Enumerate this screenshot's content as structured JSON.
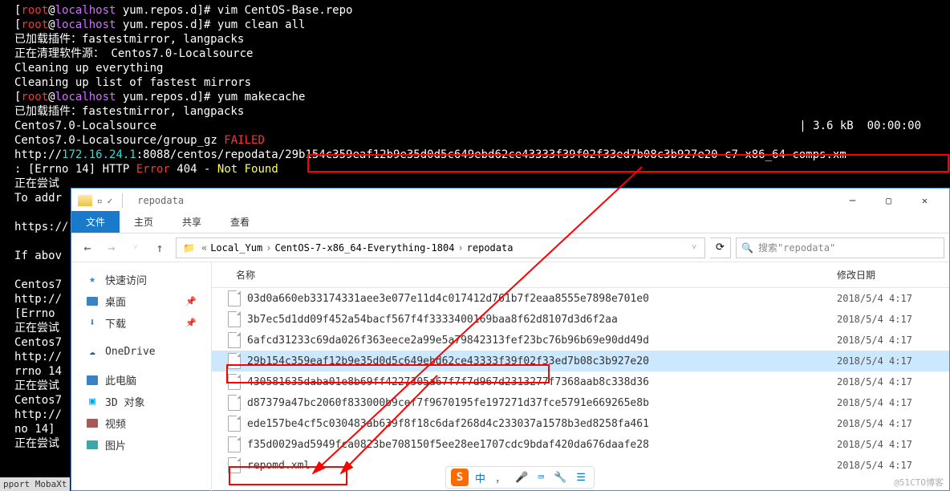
{
  "terminal": {
    "lines": [
      {
        "prompt": true,
        "cmd": "vim CentOS-Base.repo"
      },
      {
        "prompt": true,
        "cmd": "yum clean all"
      },
      {
        "text": "已加载插件：fastestmirror, langpacks"
      },
      {
        "text": "正在清理软件源： Centos7.0-Localsource"
      },
      {
        "text": "Cleaning up everything"
      },
      {
        "text": "Cleaning up list of fastest mirrors"
      },
      {
        "prompt": true,
        "cmd": "yum makecache"
      },
      {
        "text": "已加载插件：fastestmirror, langpacks"
      },
      {
        "text_left": "Centos7.0-Localsource",
        "text_right": "| 3.6 kB  00:00:00"
      },
      {
        "segments": [
          {
            "t": "Centos7.0-Localsource/group_gz ",
            "c": "w"
          },
          {
            "t": "FAILED",
            "c": "red"
          }
        ]
      },
      {
        "segments": [
          {
            "t": "http://",
            "c": "w"
          },
          {
            "t": "172.16.24.1",
            "c": "cyan"
          },
          {
            "t": ":8088/centos/repodata/29b154c359eaf12b9e35d0d5c649ebd62ce43333f39f02f33ed7b08c3b927e20-c7-x86_64-comps.xm",
            "c": "w"
          }
        ]
      },
      {
        "segments": [
          {
            "t": ": [Errno 14] HTTP ",
            "c": "w"
          },
          {
            "t": "Error",
            "c": "red"
          },
          {
            "t": " 404 - ",
            "c": "w"
          },
          {
            "t": "Not Found",
            "c": "yellow"
          }
        ]
      },
      {
        "text": "正在尝试"
      },
      {
        "text": "To addr"
      },
      {
        "text": ""
      },
      {
        "text": "https://"
      },
      {
        "text": ""
      },
      {
        "text": "If abov"
      },
      {
        "text": ""
      },
      {
        "text": "Centos7"
      },
      {
        "text": "http://"
      },
      {
        "text": "[Errno "
      },
      {
        "text": "正在尝试"
      },
      {
        "text": "Centos7"
      },
      {
        "text": "http://"
      },
      {
        "text": "rrno 14"
      },
      {
        "text": "正在尝试"
      },
      {
        "text": "Centos7"
      },
      {
        "text": "http://"
      },
      {
        "text": "no 14] "
      },
      {
        "text": "正在尝试"
      }
    ],
    "prompt_user": "root",
    "prompt_host": "localhost",
    "prompt_path": "yum.repos.d"
  },
  "explorer": {
    "title": "repodata",
    "tabs": {
      "file": "文件",
      "home": "主页",
      "share": "共享",
      "view": "查看"
    },
    "breadcrumb": [
      "Local_Yum",
      "CentOS-7-x86_64-Everything-1804",
      "repodata"
    ],
    "search_placeholder": "搜索\"repodata\"",
    "columns": {
      "name": "名称",
      "date": "修改日期"
    },
    "sidebar": {
      "quick": "快速访问",
      "desktop": "桌面",
      "downloads": "下载",
      "onedrive": "OneDrive",
      "thispc": "此电脑",
      "3d": "3D 对象",
      "videos": "视频",
      "pictures": "图片"
    },
    "files": [
      {
        "name": "03d0a660eb33174331aee3e077e11d4c017412d761b7f2eaa8555e7898e701e0",
        "date": "2018/5/4 4:17"
      },
      {
        "name": "3b7ec5d1dd09f452a54bacf567f4f3333400169baa8f62d8107d3d6f2aa",
        "date": "2018/5/4 4:17"
      },
      {
        "name": "6afcd31233c69da026f363eece2a99e5a79842313fef23bc76b96b69e90dd49d",
        "date": "2018/5/4 4:17"
      },
      {
        "name": "29b154c359eaf12b9e35d0d5c649ebd62ce43333f39f02f33ed7b08c3b927e20",
        "date": "2018/5/4 4:17",
        "selected": true
      },
      {
        "name": "430581635daba01e8b69ff4227305a67f7f7d967d2313277f7368aab8c338d36",
        "date": "2018/5/4 4:17"
      },
      {
        "name": "d87379a47bc2060f833000b9cef7f9670195fe197271d37fce5791e669265e8b",
        "date": "2018/5/4 4:17"
      },
      {
        "name": "ede157be4cf5c030483ab639f8f18c6daf268d4c233037a1578b3ed8258fa461",
        "date": "2018/5/4 4:17"
      },
      {
        "name": "f35d0029ad5949fca0823be708150f5ee28ee1707cdc9bdaf420da676daafe28",
        "date": "2018/5/4 4:17"
      },
      {
        "name": "repomd.xml",
        "date": "2018/5/4 4:17"
      }
    ]
  },
  "ime": {
    "lang": "中",
    "punct": "，",
    "mic": "🎤",
    "kbd": "⌨",
    "tool": "🔧",
    "menu": "☰"
  },
  "watermark": "@51CTO博客",
  "footer": "pport MobaXt"
}
